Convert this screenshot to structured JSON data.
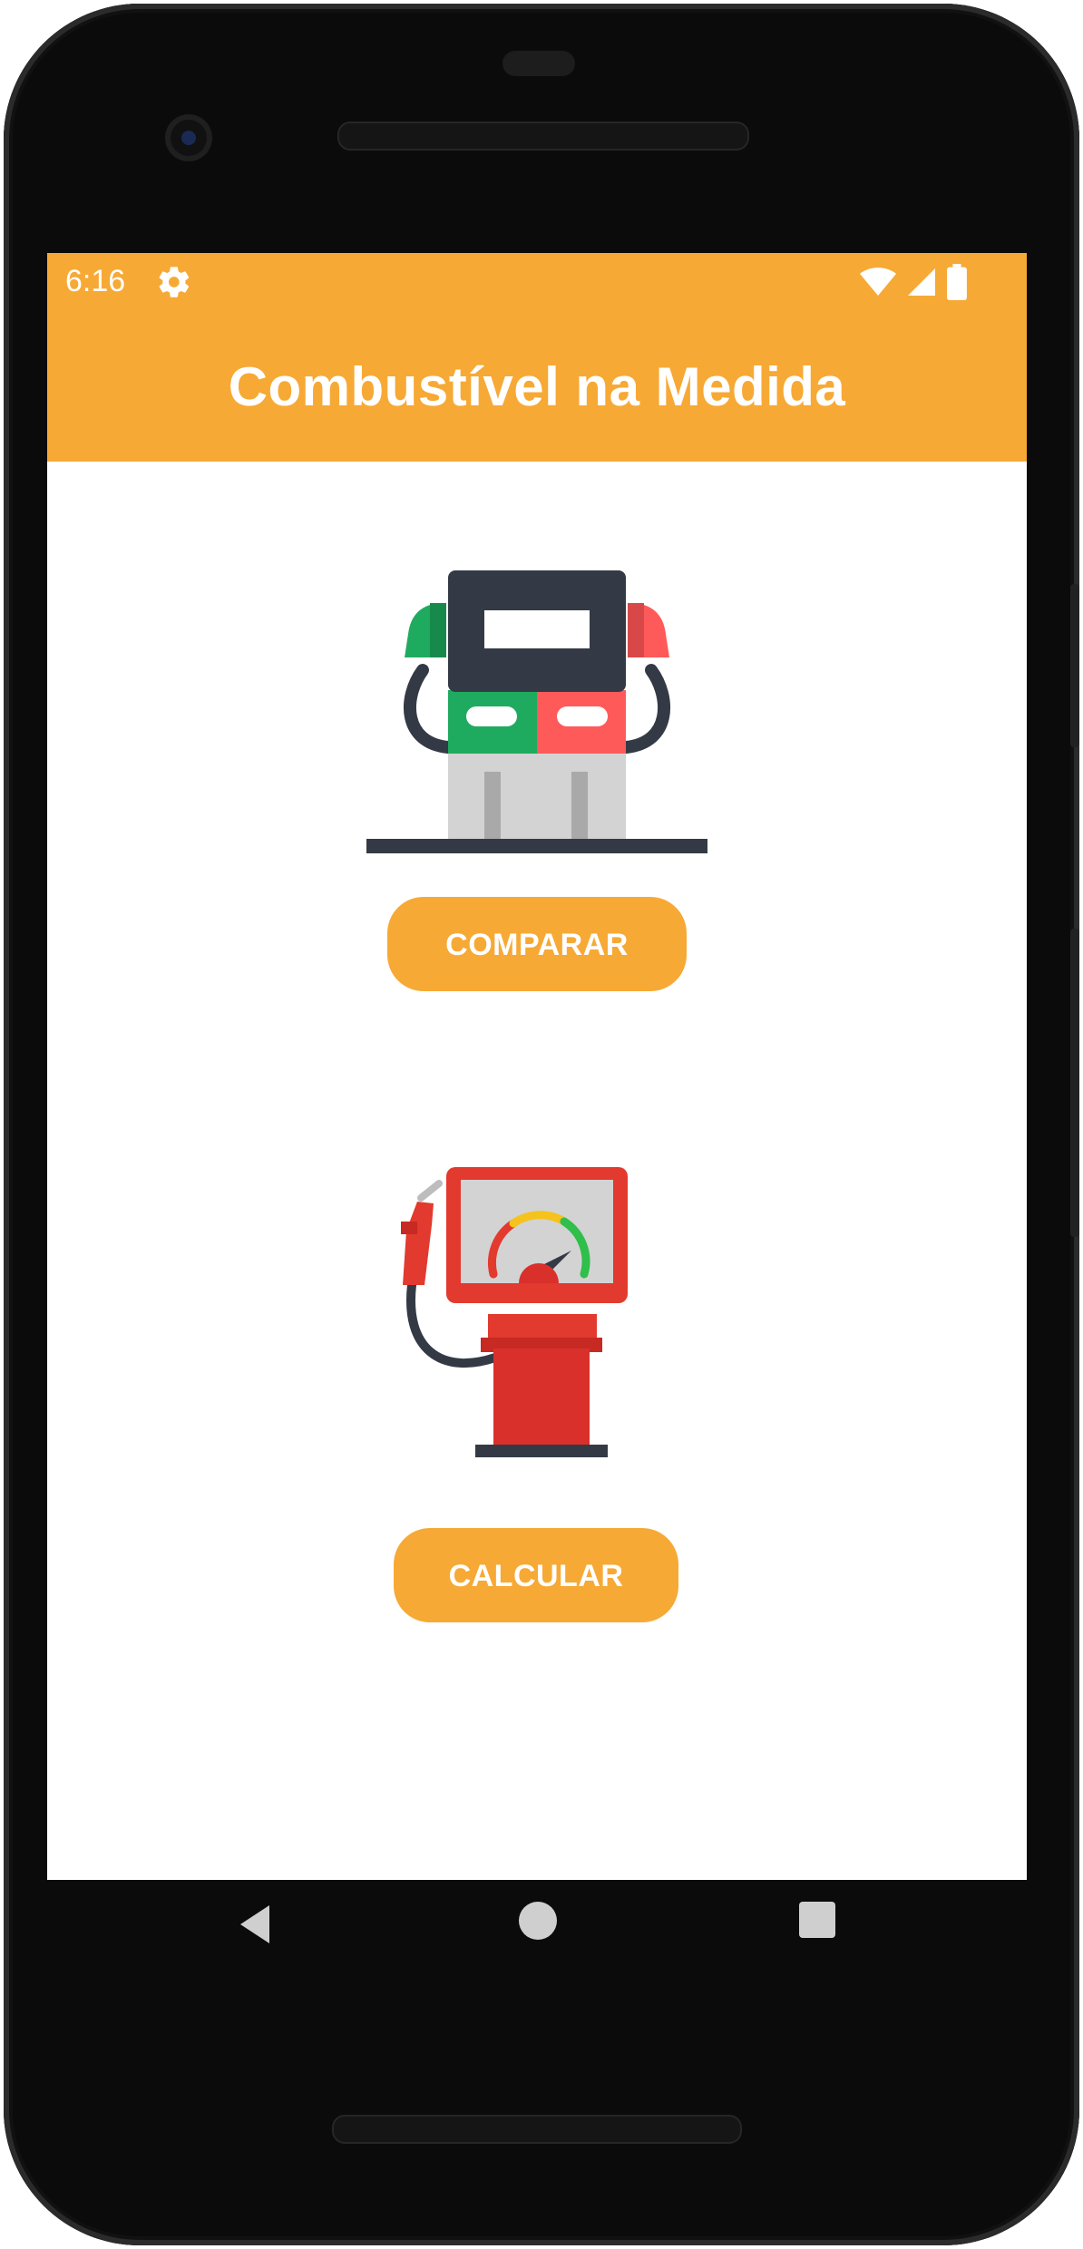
{
  "status_bar": {
    "time": "6:16",
    "icons": [
      "gear-icon",
      "wifi-icon",
      "signal-icon",
      "battery-icon"
    ]
  },
  "app_bar": {
    "title": "Combustível na Medida"
  },
  "main": {
    "images": [
      "fuel-pump-image",
      "fuel-gauge-pump-image"
    ],
    "compare_button_label": "COMPARAR",
    "calculate_button_label": "CALCULAR"
  },
  "navigation_bar": {
    "buttons": [
      "back-icon",
      "home-icon",
      "recent-apps-icon"
    ]
  },
  "colors": {
    "accent": "#f7a935",
    "pump_dark": "#343a45",
    "pump_green": "#1fab5f",
    "pump_red": "#ff5a5a",
    "pump_gray": "#d3d3d3",
    "gauge_red": "#d9302b"
  }
}
